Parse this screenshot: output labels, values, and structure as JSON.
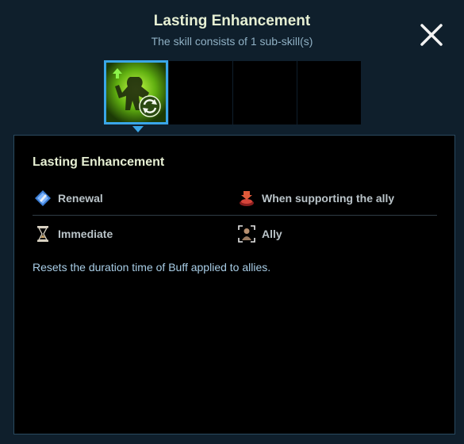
{
  "header": {
    "title": "Lasting Enhancement",
    "subtitle": "The skill consists of 1 sub-skill(s)"
  },
  "close": {
    "icon": "close-icon"
  },
  "subskills": {
    "slots": [
      {
        "icon": "lasting-enhancement-skill-icon",
        "active": true
      },
      {
        "icon": "empty-slot",
        "active": false
      },
      {
        "icon": "empty-slot",
        "active": false
      },
      {
        "icon": "empty-slot",
        "active": false
      }
    ]
  },
  "detail": {
    "title": "Lasting Enhancement",
    "properties": [
      {
        "icon": "renewal-icon",
        "label": "Renewal"
      },
      {
        "icon": "support-ally-icon",
        "label": "When supporting the ally"
      },
      {
        "icon": "hourglass-icon",
        "label": "Immediate"
      },
      {
        "icon": "ally-target-icon",
        "label": "Ally"
      }
    ],
    "description": "Resets the duration time of Buff applied to allies."
  },
  "colors": {
    "background": "#0f1f2c",
    "panel": "#000000",
    "accent": "#3aa6e8",
    "title": "#e6efd3",
    "description": "#a8cde6"
  }
}
